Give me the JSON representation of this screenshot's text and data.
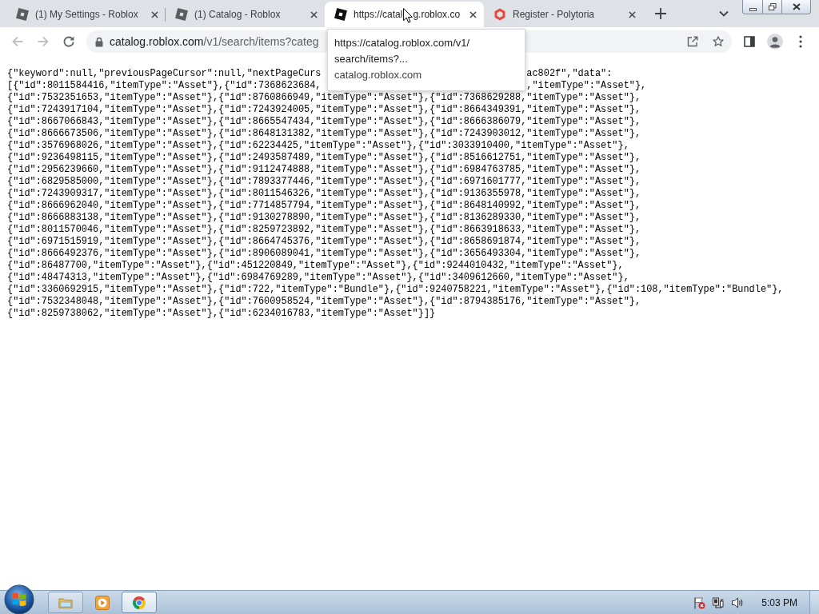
{
  "tabs": [
    {
      "title_parts": [
        "(1) My Settings - Roblox"
      ],
      "selected": false,
      "kind": "tile",
      "color": "#5c5c5c"
    },
    {
      "title_parts": [
        "(1) Catalog - Roblox"
      ],
      "selected": false,
      "kind": "tile",
      "color": "#5c5c5c"
    },
    {
      "title_parts": [
        "https://catal",
        "g.roblox.co"
      ],
      "selected": true,
      "kind": "tile",
      "color": "#111111"
    },
    {
      "title_parts": [
        "Register - Polytoria"
      ],
      "selected": false,
      "kind": "hexagon",
      "color": "#e8473b"
    }
  ],
  "nav_buttons": [
    {
      "kind": "back",
      "disabled": true
    },
    {
      "kind": "forward",
      "disabled": true
    },
    {
      "kind": "reload",
      "disabled": false
    }
  ],
  "address_bar": {
    "host": "catalog.roblox.com",
    "path": "/v1/search/items?categ"
  },
  "tooltip": {
    "title_lines": [
      "https://catalog.roblox.com/v1/",
      "search/items?..."
    ],
    "domain": "catalog.roblox.com"
  },
  "page": {
    "lines": [
      [
        "{\"keyword\":null,\"previousPageCursor\":null,\"nextPageCurs",
        "ac802f\",\"data\":"
      ],
      [
        "[{\"id\":8011584416,\"itemType\":\"Asset\"},{\"id\":7368623684,",
        ",\"itemType\":\"Asset\"},"
      ],
      [
        "{\"id\":7532351653,\"itemType\":\"Asset\"},{\"id\":8760866949,\"itemType\":\"Asset\"},{\"id\":7368629288,\"itemType\":\"Asset\"},"
      ],
      [
        "{\"id\":7243917104,\"itemType\":\"Asset\"},{\"id\":7243924005,\"itemType\":\"Asset\"},{\"id\":8664349391,\"itemType\":\"Asset\"},"
      ],
      [
        "{\"id\":8667066843,\"itemType\":\"Asset\"},{\"id\":8665547434,\"itemType\":\"Asset\"},{\"id\":8666386079,\"itemType\":\"Asset\"},"
      ],
      [
        "{\"id\":8666673506,\"itemType\":\"Asset\"},{\"id\":8648131382,\"itemType\":\"Asset\"},{\"id\":7243903012,\"itemType\":\"Asset\"},"
      ],
      [
        "{\"id\":3576968026,\"itemType\":\"Asset\"},{\"id\":62234425,\"itemType\":\"Asset\"},{\"id\":3033910400,\"itemType\":\"Asset\"},"
      ],
      [
        "{\"id\":9236498115,\"itemType\":\"Asset\"},{\"id\":2493587489,\"itemType\":\"Asset\"},{\"id\":8516612751,\"itemType\":\"Asset\"},"
      ],
      [
        "{\"id\":2956239660,\"itemType\":\"Asset\"},{\"id\":9112474888,\"itemType\":\"Asset\"},{\"id\":6984763785,\"itemType\":\"Asset\"},"
      ],
      [
        "{\"id\":6829585000,\"itemType\":\"Asset\"},{\"id\":7893377446,\"itemType\":\"Asset\"},{\"id\":6971601777,\"itemType\":\"Asset\"},"
      ],
      [
        "{\"id\":7243909317,\"itemType\":\"Asset\"},{\"id\":8011546326,\"itemType\":\"Asset\"},{\"id\":9136355978,\"itemType\":\"Asset\"},"
      ],
      [
        "{\"id\":8666962040,\"itemType\":\"Asset\"},{\"id\":7714857794,\"itemType\":\"Asset\"},{\"id\":8648140992,\"itemType\":\"Asset\"},"
      ],
      [
        "{\"id\":8666883138,\"itemType\":\"Asset\"},{\"id\":9130278890,\"itemType\":\"Asset\"},{\"id\":8136289330,\"itemType\":\"Asset\"},"
      ],
      [
        "{\"id\":8011570046,\"itemType\":\"Asset\"},{\"id\":8259723892,\"itemType\":\"Asset\"},{\"id\":8663918633,\"itemType\":\"Asset\"},"
      ],
      [
        "{\"id\":6971515919,\"itemType\":\"Asset\"},{\"id\":8664745376,\"itemType\":\"Asset\"},{\"id\":8658691874,\"itemType\":\"Asset\"},"
      ],
      [
        "{\"id\":8666492376,\"itemType\":\"Asset\"},{\"id\":8906089041,\"itemType\":\"Asset\"},{\"id\":3656493304,\"itemType\":\"Asset\"},"
      ],
      [
        "{\"id\":86487700,\"itemType\":\"Asset\"},{\"id\":451220849,\"itemType\":\"Asset\"},{\"id\":9244010432,\"itemType\":\"Asset\"},"
      ],
      [
        "{\"id\":48474313,\"itemType\":\"Asset\"},{\"id\":6984769289,\"itemType\":\"Asset\"},{\"id\":3409612660,\"itemType\":\"Asset\"},"
      ],
      [
        "{\"id\":3360692915,\"itemType\":\"Asset\"},{\"id\":722,\"itemType\":\"Bundle\"},{\"id\":9240758221,\"itemType\":\"Asset\"},{\"id\":108,\"itemType\":\"Bundle\"},"
      ],
      [
        "{\"id\":7532348048,\"itemType\":\"Asset\"},{\"id\":7600958524,\"itemType\":\"Asset\"},{\"id\":8794385176,\"itemType\":\"Asset\"},"
      ],
      [
        "{\"id\":8259738062,\"itemType\":\"Asset\"},{\"id\":6234016783,\"itemType\":\"Asset\"}]}"
      ]
    ]
  },
  "taskbar": {
    "apps": [
      {
        "kind": "folder",
        "running": true,
        "selected": false
      },
      {
        "kind": "media",
        "running": false,
        "selected": false
      },
      {
        "kind": "browser",
        "running": true,
        "selected": true
      }
    ],
    "clock": "5:03 PM"
  }
}
